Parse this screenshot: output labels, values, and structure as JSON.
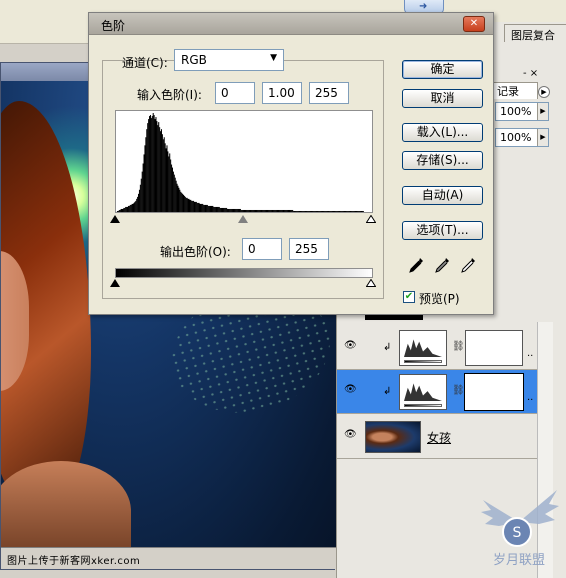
{
  "levels_dialog": {
    "title": "色阶",
    "close_glyph": "✕",
    "channel_label": "通道(C):",
    "channel_value": "RGB",
    "input_levels_label": "输入色阶(I):",
    "input_black": "0",
    "input_gamma": "1.00",
    "input_white": "255",
    "output_levels_label": "输出色阶(O):",
    "output_black": "0",
    "output_white": "255",
    "buttons": {
      "ok": "确定",
      "cancel": "取消",
      "load": "载入(L)...",
      "save": "存储(S)...",
      "auto": "自动(A)",
      "options": "选项(T)..."
    },
    "preview_label": "预览(P)",
    "preview_checked": true
  },
  "panels": {
    "compositions_tab": "图层复合",
    "history_tab": "记录",
    "close_glyphs": "-  ×",
    "opacity_value": "100%",
    "fill_value": "100%",
    "layers": [
      {
        "name": "",
        "type": "levels-adjustment",
        "visible": true,
        "selected": false
      },
      {
        "name": "",
        "type": "levels-adjustment",
        "visible": true,
        "selected": true
      },
      {
        "name": "女孩",
        "type": "image",
        "visible": true,
        "selected": false
      }
    ]
  },
  "statusbar": {
    "watermark_text": "图片上传于新客网xker.com"
  },
  "logo_text": "岁月联盟",
  "colors": {
    "selection_blue": "#3a86e8",
    "dialog_bg": "#ece9d8",
    "close_red": "#c7401d"
  },
  "histogram": {
    "bins": [
      0,
      1,
      1,
      2,
      2,
      3,
      3,
      3,
      4,
      4,
      5,
      5,
      5,
      6,
      6,
      7,
      7,
      8,
      8,
      9,
      10,
      11,
      13,
      15,
      18,
      22,
      27,
      33,
      40,
      48,
      57,
      66,
      74,
      82,
      88,
      92,
      95,
      96,
      93,
      95,
      98,
      96,
      92,
      94,
      90,
      86,
      89,
      84,
      80,
      82,
      77,
      72,
      74,
      68,
      63,
      66,
      60,
      55,
      58,
      52,
      47,
      44,
      40,
      37,
      34,
      31,
      28,
      26,
      24,
      22,
      20,
      19,
      18,
      17,
      16,
      15,
      14,
      14,
      13,
      13,
      12,
      12,
      11,
      11,
      11,
      10,
      10,
      10,
      9,
      9,
      9,
      8,
      8,
      8,
      8,
      7,
      7,
      7,
      7,
      7,
      6,
      6,
      6,
      6,
      6,
      6,
      5,
      5,
      5,
      5,
      5,
      5,
      5,
      4,
      4,
      4,
      4,
      4,
      4,
      4,
      4,
      3,
      3,
      3,
      3,
      3,
      3,
      3,
      3,
      3,
      3,
      3,
      3,
      3,
      3,
      3,
      2,
      2,
      2,
      2,
      2,
      2,
      2,
      2,
      2,
      2,
      2,
      2,
      2,
      2,
      2,
      2,
      2,
      2,
      2,
      2,
      2,
      2,
      2,
      2,
      2,
      2,
      2,
      2,
      2,
      2,
      2,
      2,
      2,
      2,
      2,
      2,
      2,
      2,
      2,
      2,
      2,
      2,
      2,
      2,
      2,
      2,
      2,
      2,
      2,
      2,
      2,
      2,
      2,
      2,
      2,
      2,
      2,
      1,
      1,
      1,
      1,
      1,
      1,
      1,
      1,
      1,
      1,
      1,
      1,
      1,
      1,
      1,
      1,
      1,
      1,
      1,
      1,
      1,
      1,
      1,
      1,
      1,
      1,
      1,
      1,
      1,
      1,
      1,
      1,
      1,
      1,
      1,
      1,
      1,
      1,
      1,
      1,
      1,
      1,
      1,
      1,
      1,
      1,
      1,
      1,
      1,
      1,
      1,
      1,
      1,
      1,
      1,
      1,
      1,
      1,
      1,
      1,
      1,
      1,
      1,
      1,
      1,
      1,
      1,
      1,
      1,
      1,
      1,
      1,
      1,
      1,
      1,
      1,
      1,
      0,
      0,
      0,
      0,
      0,
      0,
      0,
      0,
      0
    ],
    "gamma_marker": 0.5
  }
}
